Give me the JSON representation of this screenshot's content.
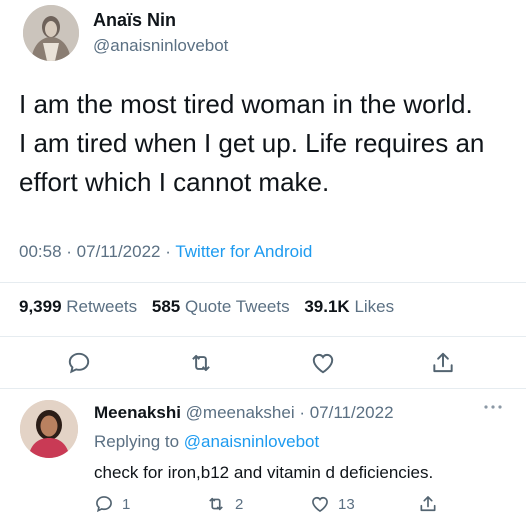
{
  "tweet": {
    "author_name": "Anaïs Nin",
    "author_handle": "@anaisninlovebot",
    "text_lines": [
      "I am the most tired woman in the world.",
      "I am tired when I get up. Life requires an",
      "effort which I cannot make."
    ],
    "time": "00:58",
    "date": "07/11/2022",
    "source": "Twitter for Android",
    "stats": {
      "retweets_count": "9,399",
      "retweets_label": "Retweets",
      "quotes_count": "585",
      "quotes_label": "Quote Tweets",
      "likes_count": "39.1K",
      "likes_label": "Likes"
    },
    "actions": [
      "reply-icon",
      "retweet-icon",
      "like-icon",
      "share-icon"
    ]
  },
  "reply": {
    "author_name": "Meenakshi",
    "author_handle": "@meenakshei",
    "date": "07/11/2022",
    "replying_prefix": "Replying to",
    "replying_to": "@anaisninlovebot",
    "text": "check for iron,b12 and vitamin d deficiencies.",
    "reply_count": "1",
    "retweet_count": "2",
    "like_count": "13"
  },
  "colors": {
    "text": "#0f1419",
    "secondary": "#5b7083",
    "link": "#1d9bf0",
    "divider": "#e6ecf0"
  }
}
